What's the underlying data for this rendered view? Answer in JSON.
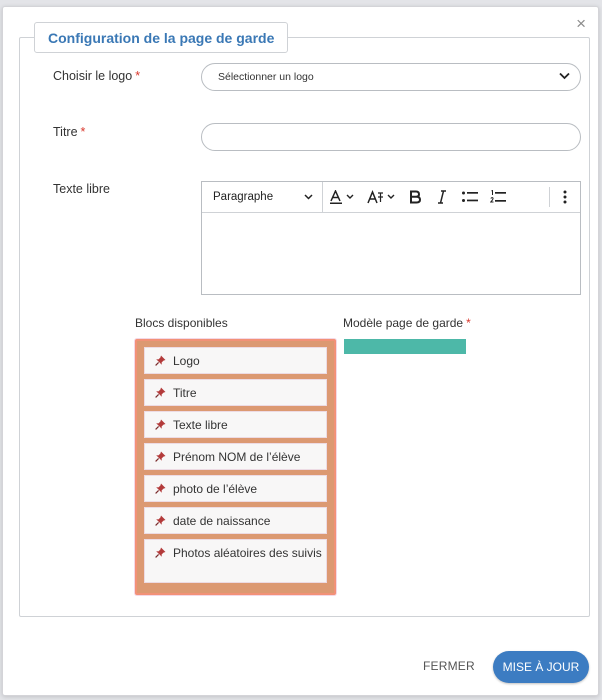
{
  "dialog": {
    "title": "Configuration de la page de garde",
    "close_symbol": "×"
  },
  "form": {
    "logo_label": "Choisir le logo",
    "logo_select_value": "Sélectionner un logo",
    "title_label": "Titre",
    "title_value": "",
    "free_text_label": "Texte libre",
    "required_mark": "*"
  },
  "editor": {
    "heading_value": "Paragraphe",
    "body_text": "",
    "toolbar_icons": [
      "font-color-icon",
      "font-size-icon",
      "bold-icon",
      "italic-icon",
      "bulleted-list-icon",
      "numbered-list-icon",
      "more-options-icon"
    ]
  },
  "blocks": {
    "label": "Blocs disponibles",
    "items": [
      "Logo",
      "Titre",
      "Texte libre",
      "Prénom NOM de l’élève",
      "photo de l’élève",
      "date de naissance",
      "Photos aléatoires des suivis"
    ]
  },
  "model": {
    "label": "Modèle page de garde"
  },
  "footer": {
    "close_label": "FERMER",
    "update_label": "MISE À JOUR"
  },
  "colors": {
    "accent": "#3c7cc2",
    "title": "#3a78b5",
    "required": "#d9362b",
    "blocks_box": "#dc9972",
    "model_bar": "#4db8a8"
  }
}
